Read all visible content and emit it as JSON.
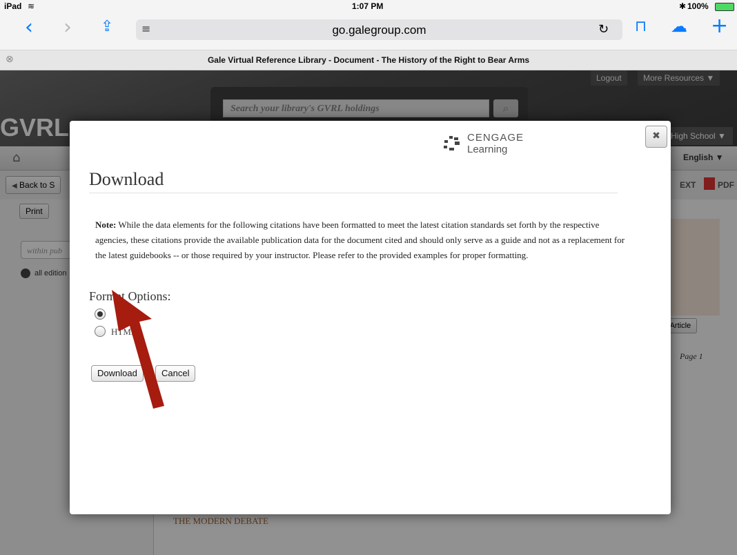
{
  "status_bar": {
    "device": "iPad",
    "time": "1:07 PM",
    "battery": "100%"
  },
  "browser": {
    "url": "go.galegroup.com",
    "tab_title": "Gale Virtual Reference Library - Document - The History of the Right to Bear Arms",
    "icons": [
      "back-icon",
      "forward-icon",
      "share-icon",
      "reader-icon",
      "reload-icon",
      "bookmarks-icon",
      "cloud-tabs-icon",
      "new-tab-icon",
      "close-tab-icon"
    ]
  },
  "site": {
    "logo": "GVRL",
    "search_placeholder": "Search your library's GVRL holdings",
    "logout": "Logout",
    "more_resources": "More Resources ▼",
    "school": "High School ▼",
    "language": "English ▼",
    "back_button": "Back to S",
    "print": "Print",
    "within_placeholder": "within pub",
    "all_editions": "all edition",
    "text_tab": "EXT",
    "pdf_tab": "PDF",
    "article_btn": "n Article",
    "page_label": "Page 1",
    "section_heading": "THE MODERN DEBATE"
  },
  "modal": {
    "brand_top": "CENGAGE",
    "brand_bottom": "Learning",
    "title": "Download",
    "note_label": "Note:",
    "note_text": "While the data elements for the following citations have been formatted to meet the latest citation standards set forth by the respective agencies, these citations provide the available publication data for the document cited and should only serve as a guide and not as a replacement for the latest guidebooks -- or those required by your instructor. Please refer to the provided examples for proper formatting.",
    "format_heading": "Format Options:",
    "options": [
      {
        "label": "",
        "checked": true
      },
      {
        "label": "HTML",
        "checked": false
      }
    ],
    "download_label": "Download",
    "cancel_label": "Cancel"
  },
  "colors": {
    "accent": "#0a7bff",
    "arrow": "#a61c0f",
    "heading_brown": "#a0612b"
  }
}
